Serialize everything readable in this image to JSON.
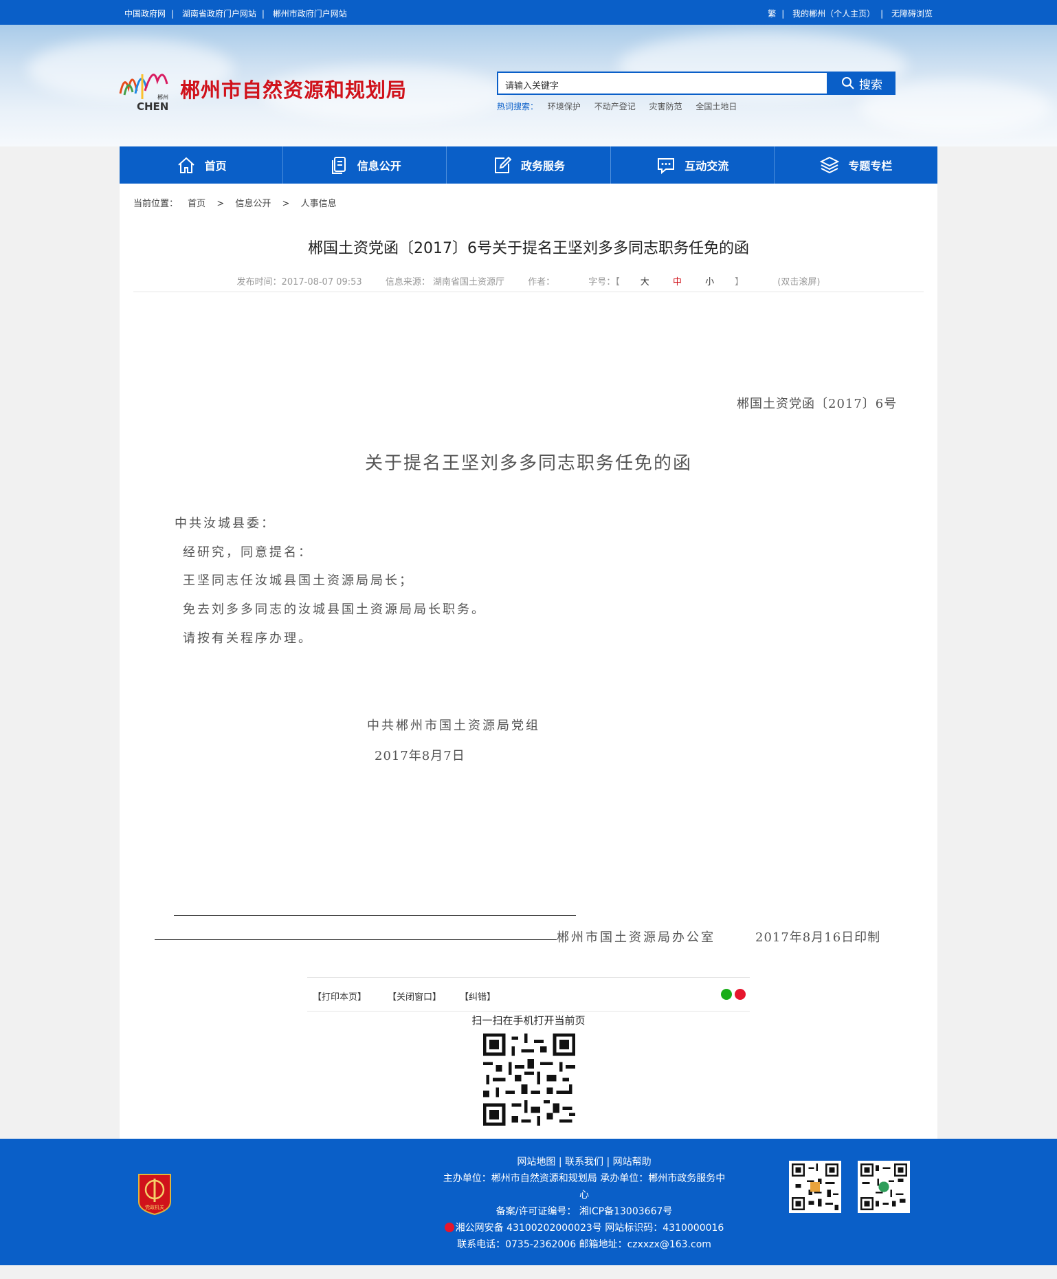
{
  "topbar": {
    "links_left": [
      "中国政府网",
      "湖南省政府门户网站",
      "郴州市政府门户网站"
    ],
    "links_right": [
      "繁",
      "我的郴州（个人主页）",
      "无障碍浏览"
    ]
  },
  "header": {
    "logo_text": "CHEN",
    "logo_sub": "郴州",
    "site_title": "郴州市自然资源和规划局",
    "search_placeholder": "请输入关键字",
    "search_button": "搜索",
    "hot_label": "热词搜索：",
    "hot_keywords": [
      "环境保护",
      "不动产登记",
      "灾害防范",
      "全国土地日"
    ]
  },
  "nav": {
    "items": [
      {
        "label": "首页",
        "icon": "home-icon"
      },
      {
        "label": "信息公开",
        "icon": "document-icon"
      },
      {
        "label": "政务服务",
        "icon": "edit-icon"
      },
      {
        "label": "互动交流",
        "icon": "chat-icon"
      },
      {
        "label": "专题专栏",
        "icon": "layers-icon"
      }
    ]
  },
  "breadcrumb": {
    "label": "当前位置：",
    "items": [
      "首页",
      "信息公开",
      "人事信息"
    ],
    "sep": ">"
  },
  "article": {
    "title": "郴国土资党函〔2017〕6号关于提名王坚刘多多同志职务任免的函",
    "publish_time": "发布时间：2017-08-07 09:53",
    "source": "信息来源：  湖南省国土资源厅",
    "author": "作者：",
    "font_label": "字号：【",
    "font_large": "大",
    "font_mid": "中",
    "font_small": "小",
    "font_end": "】",
    "fullscreen": "(双击滚屏)"
  },
  "document": {
    "number": "郴国土资党函〔2017〕6号",
    "title": "关于提名王坚刘多多同志职务任免的函",
    "salutation": "中共汝城县委：",
    "body": [
      "经研究，同意提名：",
      "王坚同志任汝城县国土资源局局长；",
      "免去刘多多同志的汝城县国土资源局局长职务。",
      "请按有关程序办理。"
    ],
    "sign_org": "中共郴州市国土资源局党组",
    "sign_date": "2017年8月7日",
    "print_office": "郴州市国土资源局办公室",
    "print_date": "2017年8月16日印制"
  },
  "actions": {
    "print": "【打印本页】",
    "close": "【关闭窗口】",
    "correct": "【纠错】",
    "scan_text": "扫一扫在手机打开当前页",
    "colors": {
      "wechat": "#1aad19",
      "weibo": "#e6162d"
    }
  },
  "footer": {
    "links": "网站地图 | 联系我们 | 网站帮助",
    "host": "主办单位：郴州市自然资源和规划局    承办单位：郴州市政务服务中",
    "host_cont": "心",
    "icp": "备案/许可证编号： 湘ICP备13003667号",
    "police": "湘公网安备 43100202000023号    网站标识码：4310000016",
    "contact": "联系电话：0735-2362006    邮箱地址：czxxzx@163.com",
    "badge_text": "党政机关"
  },
  "colors": {
    "primary": "#0a5fc8",
    "title_red": "#d0121b"
  }
}
